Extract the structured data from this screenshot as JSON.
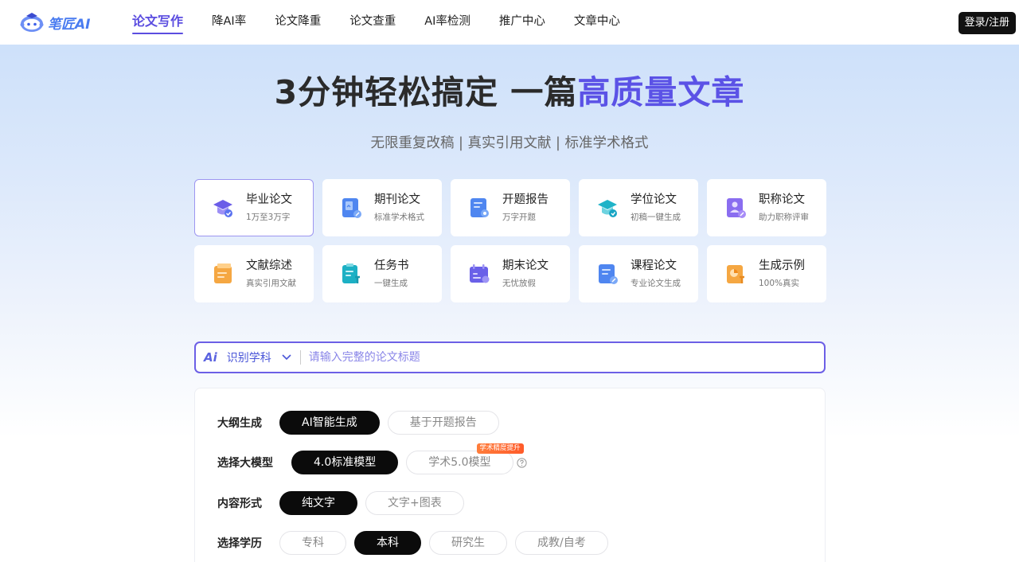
{
  "nav": {
    "logo_text": "笔匠AI",
    "items": [
      {
        "label": "论文写作",
        "active": true
      },
      {
        "label": "降AI率"
      },
      {
        "label": "论文降重"
      },
      {
        "label": "论文查重"
      },
      {
        "label": "AI率检测"
      },
      {
        "label": "推广中心"
      },
      {
        "label": "文章中心"
      }
    ],
    "login_label": "登录/注册"
  },
  "hero": {
    "title_main": "3分钟轻松搞定 一篇",
    "title_highlight": "高质量文章",
    "subtitle": "无限重复改稿 | 真实引用文献 | 标准学术格式"
  },
  "cards": [
    {
      "title": "毕业论文",
      "desc": "1万至3万字",
      "icon": "graduation-cap-icon",
      "active": true
    },
    {
      "title": "期刊论文",
      "desc": "标准学术格式",
      "icon": "journal-icon"
    },
    {
      "title": "开题报告",
      "desc": "万字开题",
      "icon": "report-icon"
    },
    {
      "title": "学位论文",
      "desc": "初稿一键生成",
      "icon": "degree-icon"
    },
    {
      "title": "职称论文",
      "desc": "助力职称评审",
      "icon": "professional-icon"
    },
    {
      "title": "文献综述",
      "desc": "真实引用文献",
      "icon": "literature-icon"
    },
    {
      "title": "任务书",
      "desc": "一键生成",
      "icon": "task-book-icon"
    },
    {
      "title": "期末论文",
      "desc": "无忧放假",
      "icon": "calendar-icon"
    },
    {
      "title": "课程论文",
      "desc": "专业论文生成",
      "icon": "course-icon"
    },
    {
      "title": "生成示例",
      "desc": "100%真实",
      "icon": "example-icon"
    }
  ],
  "search": {
    "ai_label": "Ai",
    "subject_label": "识别学科",
    "placeholder": "请输入完整的论文标题"
  },
  "options": {
    "outline": {
      "label": "大纲生成",
      "choices": [
        "AI智能生成",
        "基于开题报告"
      ],
      "selected": 0
    },
    "model": {
      "label": "选择大模型",
      "choices": [
        "4.0标准模型",
        "学术5.0模型"
      ],
      "selected": 0,
      "badge": "学术精度提升"
    },
    "content": {
      "label": "内容形式",
      "choices": [
        "纯文字",
        "文字+图表"
      ],
      "selected": 0
    },
    "education": {
      "label": "选择学历",
      "choices": [
        "专科",
        "本科",
        "研究生",
        "成教/自考"
      ],
      "selected": 1
    }
  },
  "colors": {
    "accent": "#5b4de0",
    "highlight": "#5b52e6",
    "selected_pill": "#0b0b0b",
    "badge": "#ff6a33"
  }
}
